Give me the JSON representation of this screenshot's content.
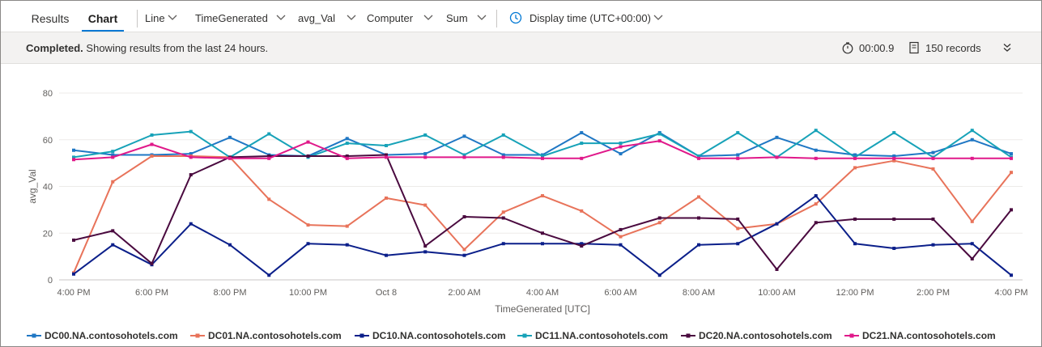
{
  "tabs": [
    {
      "label": "Results",
      "active": false
    },
    {
      "label": "Chart",
      "active": true
    }
  ],
  "toolbar": {
    "chart_type": "Line",
    "x_column": "TimeGenerated",
    "y_column": "avg_Val",
    "split_by": "Computer",
    "aggregation": "Sum",
    "display_time": "Display time (UTC+00:00)"
  },
  "status": {
    "bold": "Completed.",
    "message": "Showing results from the last 24 hours.",
    "duration": "00:00.9",
    "records": "150 records"
  },
  "colors": {
    "accent": "#0078d4",
    "DC00": "#1f77c4",
    "DC01": "#e8735a",
    "DC10": "#0b1f8a",
    "DC11": "#17a2b8",
    "DC20": "#4a0a3f",
    "DC21": "#e0198a"
  },
  "chart_data": {
    "type": "line",
    "xlabel": "TimeGenerated [UTC]",
    "ylabel": "avg_Val",
    "ylim": [
      0,
      80
    ],
    "yticks": [
      0,
      20,
      40,
      60,
      80
    ],
    "x_tick_labels": [
      "4:00 PM",
      "6:00 PM",
      "8:00 PM",
      "10:00 PM",
      "Oct 8",
      "2:00 AM",
      "4:00 AM",
      "6:00 AM",
      "8:00 AM",
      "10:00 AM",
      "12:00 PM",
      "2:00 PM",
      "4:00 PM"
    ],
    "x": [
      "4:00 PM",
      "5:00 PM",
      "6:00 PM",
      "7:00 PM",
      "8:00 PM",
      "9:00 PM",
      "10:00 PM",
      "11:00 PM",
      "Oct 8 12:00 AM",
      "1:00 AM",
      "2:00 AM",
      "3:00 AM",
      "4:00 AM",
      "5:00 AM",
      "6:00 AM",
      "7:00 AM",
      "8:00 AM",
      "9:00 AM",
      "10:00 AM",
      "11:00 AM",
      "12:00 PM",
      "1:00 PM",
      "2:00 PM",
      "3:00 PM",
      "4:00 PM"
    ],
    "grid": true,
    "legend_position": "bottom",
    "series": [
      {
        "name": "DC00.NA.contosohotels.com",
        "color_key": "DC00",
        "values": [
          55.5,
          53.5,
          53.5,
          54,
          61,
          53.5,
          53,
          60.5,
          53.5,
          54,
          61.5,
          53.5,
          53.5,
          63,
          54,
          63,
          53,
          53.5,
          61,
          55.5,
          53.5,
          53,
          54.5,
          60,
          54
        ]
      },
      {
        "name": "DC01.NA.contosohotels.com",
        "color_key": "DC01",
        "values": [
          3,
          42,
          53,
          53,
          52.5,
          34.5,
          23.5,
          23,
          35,
          32,
          13,
          29,
          36,
          29.5,
          18.5,
          24.5,
          35.5,
          22,
          24,
          32.5,
          48,
          51,
          47.5,
          25,
          46
        ]
      },
      {
        "name": "DC10.NA.contosohotels.com",
        "color_key": "DC10",
        "values": [
          2.5,
          15,
          6.5,
          24,
          15,
          2,
          15.5,
          15,
          10.5,
          12,
          10.5,
          15.5,
          15.5,
          15.5,
          15,
          2,
          15,
          15.5,
          24,
          36,
          15.5,
          13.5,
          15,
          15.5,
          2
        ]
      },
      {
        "name": "DC11.NA.contosohotels.com",
        "color_key": "DC11",
        "values": [
          52.5,
          55,
          62,
          63.5,
          52.5,
          62.5,
          52.5,
          58.5,
          57.5,
          62,
          53.5,
          62,
          53,
          58.5,
          58.5,
          62.5,
          53,
          63,
          52.5,
          64,
          52.5,
          63,
          52.5,
          64,
          52.5
        ]
      },
      {
        "name": "DC20.NA.contosohotels.com",
        "color_key": "DC20",
        "values": [
          17,
          21,
          7,
          45,
          52.5,
          53,
          53,
          53,
          53.5,
          14.5,
          27,
          26.5,
          20,
          14.5,
          21.5,
          26.5,
          26.5,
          26,
          4.5,
          24.5,
          26,
          26,
          26,
          9,
          30
        ]
      },
      {
        "name": "DC21.NA.contosohotels.com",
        "color_key": "DC21",
        "values": [
          51.5,
          52.5,
          58,
          52.5,
          52,
          52,
          59,
          52,
          52.5,
          52.5,
          52.5,
          52.5,
          52,
          52,
          57,
          59.5,
          52,
          52,
          52.5,
          52,
          52,
          52,
          52,
          52,
          52
        ]
      }
    ]
  }
}
